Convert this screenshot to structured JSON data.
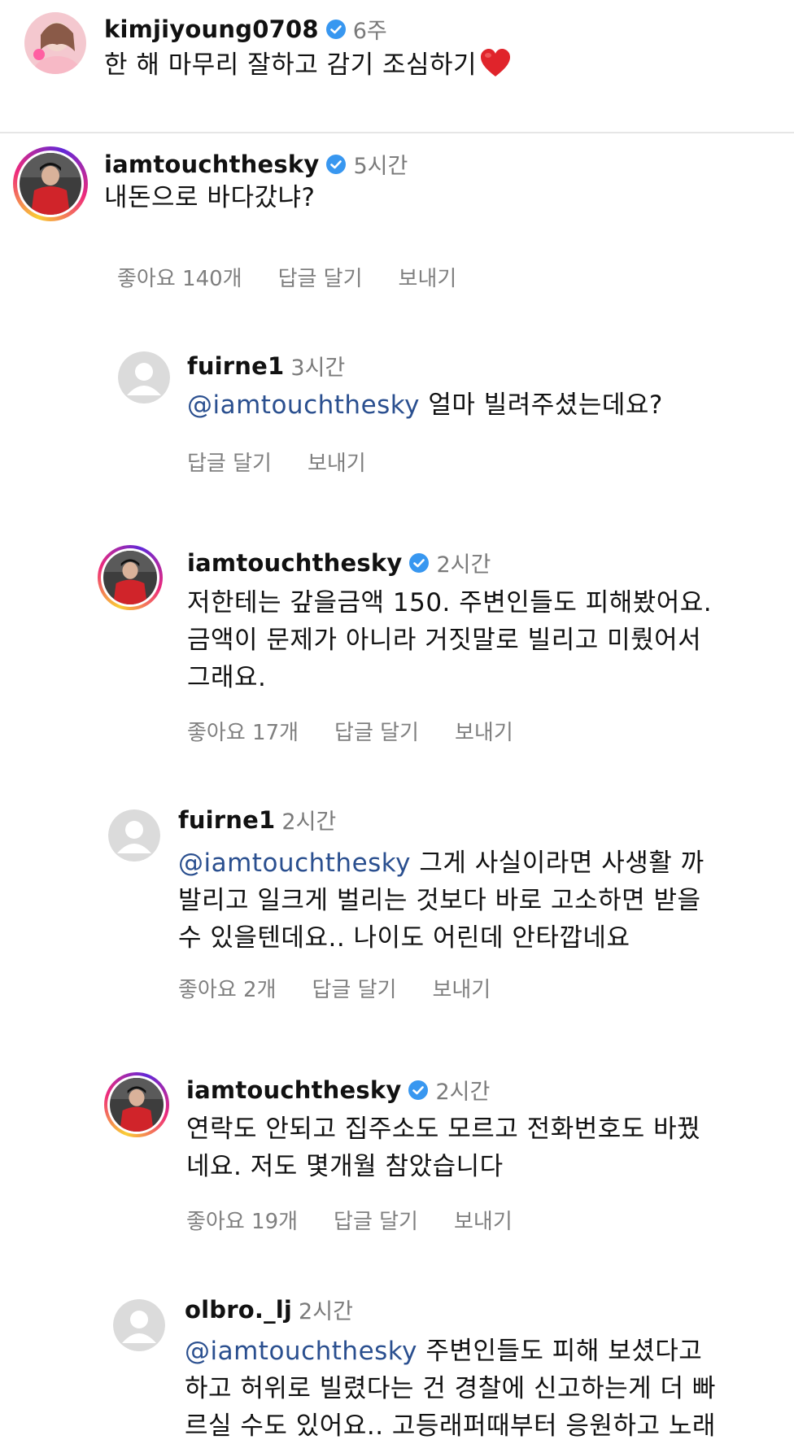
{
  "post": {
    "username": "kimjiyoung0708",
    "time": "6주",
    "caption": "한 해 마무리 잘하고 감기 조심하기",
    "caption_emoji": "heart-icon"
  },
  "comments": [
    {
      "username": "iamtouchthesky",
      "time": "5시간",
      "text": "내돈으로 바다갔냐?",
      "likes": "좋아요 140개",
      "reply": "답글 달기",
      "send": "보내기"
    },
    {
      "username": "fuirne1",
      "time": "3시간",
      "mention": "@iamtouchthesky",
      "text": " 얼마 빌려주셨는데요?",
      "reply": "답글 달기",
      "send": "보내기"
    },
    {
      "username": "iamtouchthesky",
      "time": "2시간",
      "lines": [
        "저한테는 갚을금액 150. 주변인들도 피해봤어요.",
        "금액이 문제가 아니라 거짓말로 빌리고 미뤘어서",
        "그래요."
      ],
      "likes": "좋아요 17개",
      "reply": "답글 달기",
      "send": "보내기"
    },
    {
      "username": "fuirne1",
      "time": "2시간",
      "mention": "@iamtouchthesky",
      "line1": " 그게 사실이라면 사생활 까",
      "lines": [
        "발리고 일크게 벌리는 것보다 바로 고소하면 받을",
        "수 있을텐데요.. 나이도 어린데 안타깝네요"
      ],
      "likes": "좋아요 2개",
      "reply": "답글 달기",
      "send": "보내기"
    },
    {
      "username": "iamtouchthesky",
      "time": "2시간",
      "lines": [
        "연락도 안되고 집주소도 모르고 전화번호도 바꿨",
        "네요. 저도 몇개월 참았습니다"
      ],
      "likes": "좋아요 19개",
      "reply": "답글 달기",
      "send": "보내기"
    },
    {
      "username": "olbro._lj",
      "time": "2시간",
      "mention": "@iamtouchthesky",
      "line1": " 주변인들도 피해 보셨다고",
      "lines": [
        "하고 허위로 빌렸다는 건 경찰에 신고하는게 더 빠",
        "르실 수도 있어요.. 고등래퍼때부터 응원하고 노래"
      ]
    }
  ],
  "colors": {
    "mention": "#2a4f8f",
    "verified": "#3897f0",
    "heart": "#e0242b",
    "meta": "#7f7f7f"
  }
}
